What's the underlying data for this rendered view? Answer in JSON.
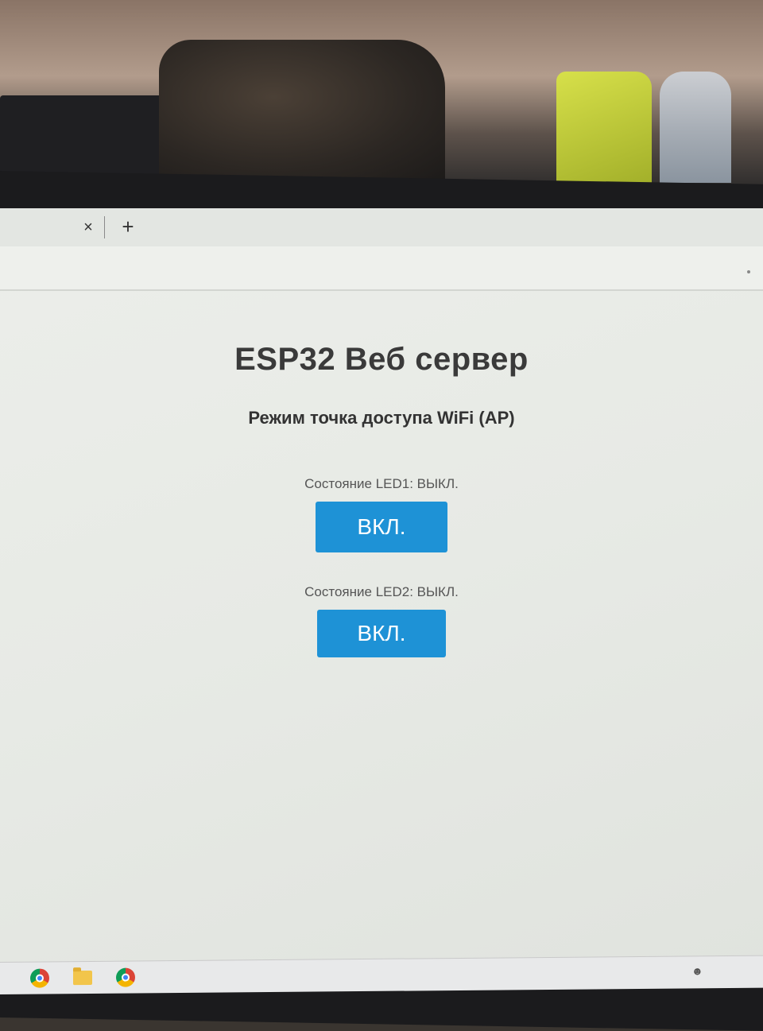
{
  "browser": {
    "tab_close_glyph": "×",
    "new_tab_glyph": "+"
  },
  "page": {
    "title": "ESP32 Веб сервер",
    "subtitle": "Режим точка доступа WiFi (AP)",
    "leds": [
      {
        "status_text": "Состояние LED1: ВЫКЛ.",
        "button_label": "ВКЛ."
      },
      {
        "status_text": "Состояние LED2: ВЫКЛ.",
        "button_label": "ВКЛ."
      }
    ]
  },
  "taskbar": {
    "items": [
      {
        "icon": "chrome-icon"
      },
      {
        "icon": "folder-icon"
      },
      {
        "icon": "chrome-icon"
      }
    ],
    "tray_icon": "people-icon"
  },
  "colors": {
    "button_bg": "#1e92d6",
    "button_text": "#ffffff",
    "page_bg": "#eceeea",
    "title_text": "#3a3a3a"
  }
}
